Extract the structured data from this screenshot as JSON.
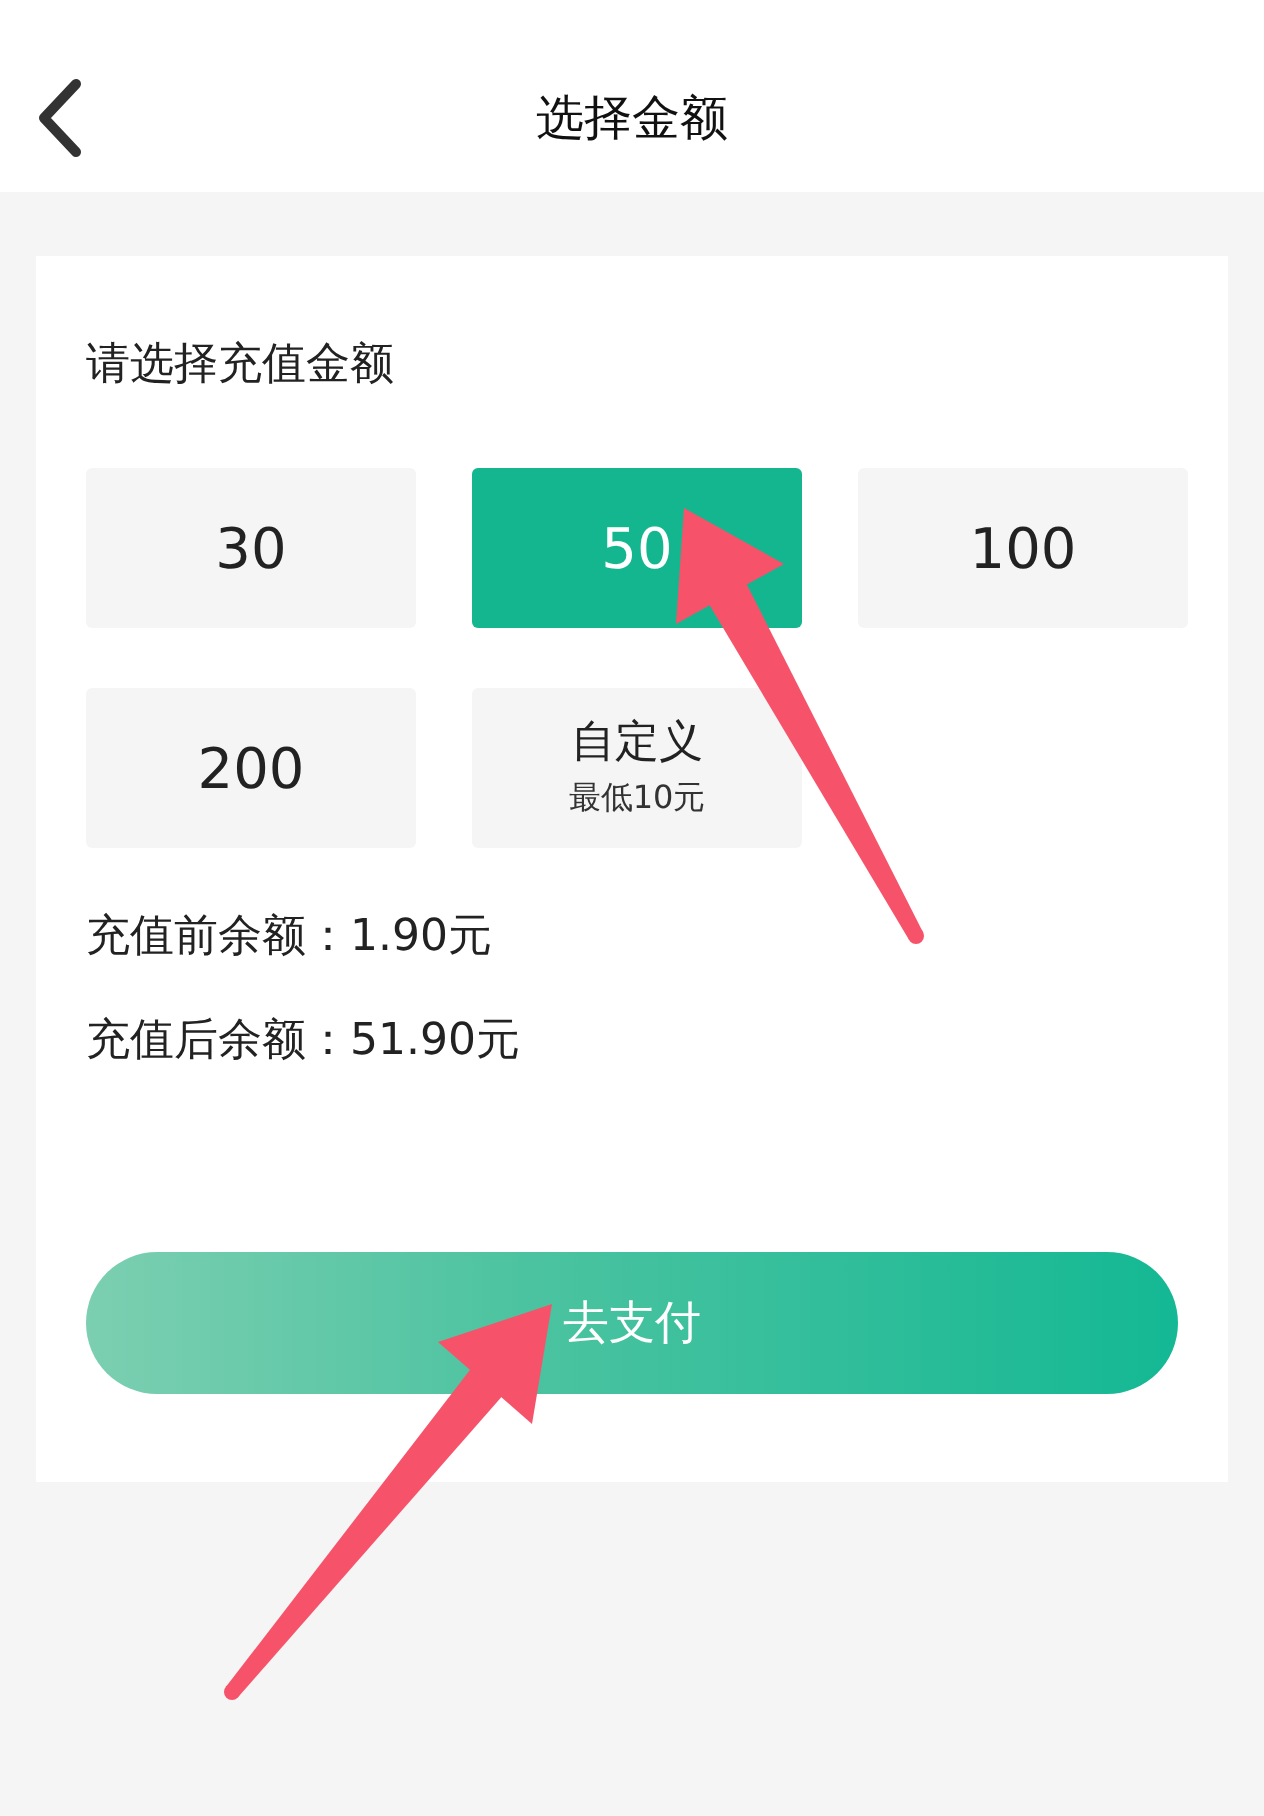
{
  "header": {
    "title": "选择金额"
  },
  "card": {
    "heading": "请选择充值金额",
    "amounts": [
      {
        "kind": "amount",
        "label": "30",
        "selected": false
      },
      {
        "kind": "amount",
        "label": "50",
        "selected": true
      },
      {
        "kind": "amount",
        "label": "100",
        "selected": false
      },
      {
        "kind": "amount",
        "label": "200",
        "selected": false
      },
      {
        "kind": "custom",
        "label": "自定义",
        "note": "最低10元",
        "selected": false
      }
    ],
    "balances": [
      "充值前余额：1.90元",
      "充值后余额：51.90元"
    ],
    "pay_button": "去支付"
  }
}
